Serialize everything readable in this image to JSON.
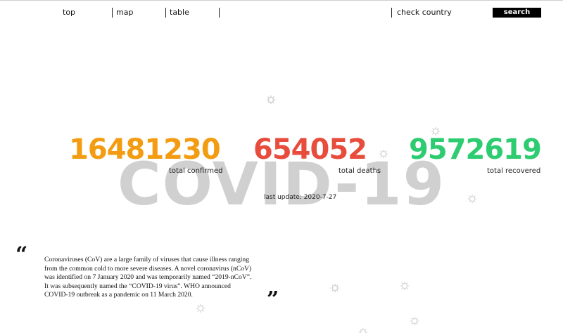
{
  "nav": {
    "top": "top",
    "map": "map",
    "table": "table",
    "check_country": "check country",
    "search": "search"
  },
  "hero": {
    "background_title": "COVID-19",
    "confirmed": "16481230",
    "confirmed_label": "total confirmed",
    "deaths": "654052",
    "deaths_label": "total deaths",
    "recovered": "9572619",
    "recovered_label": "total recovered",
    "last_update": "last update: 2020-7-27"
  },
  "quote": {
    "open_mark": "“",
    "close_mark": "”",
    "text": "Coronaviruses (CoV) are a large family of viruses that cause illness ranging from the common cold to more severe diseases. A novel coronavirus (nCoV) was identified on 7 January 2020 and was temporarily named “2019-nCoV”. It was subsequently named the “COVID-19 virus”. WHO announced COVID-19 outbreak as a pandemic on 11 March 2020."
  },
  "colors": {
    "confirmed": "#f39c12",
    "deaths": "#e74c3c",
    "recovered": "#2ecc71",
    "background_title": "#d0d0d0"
  },
  "icons": [
    "virus-icon"
  ]
}
